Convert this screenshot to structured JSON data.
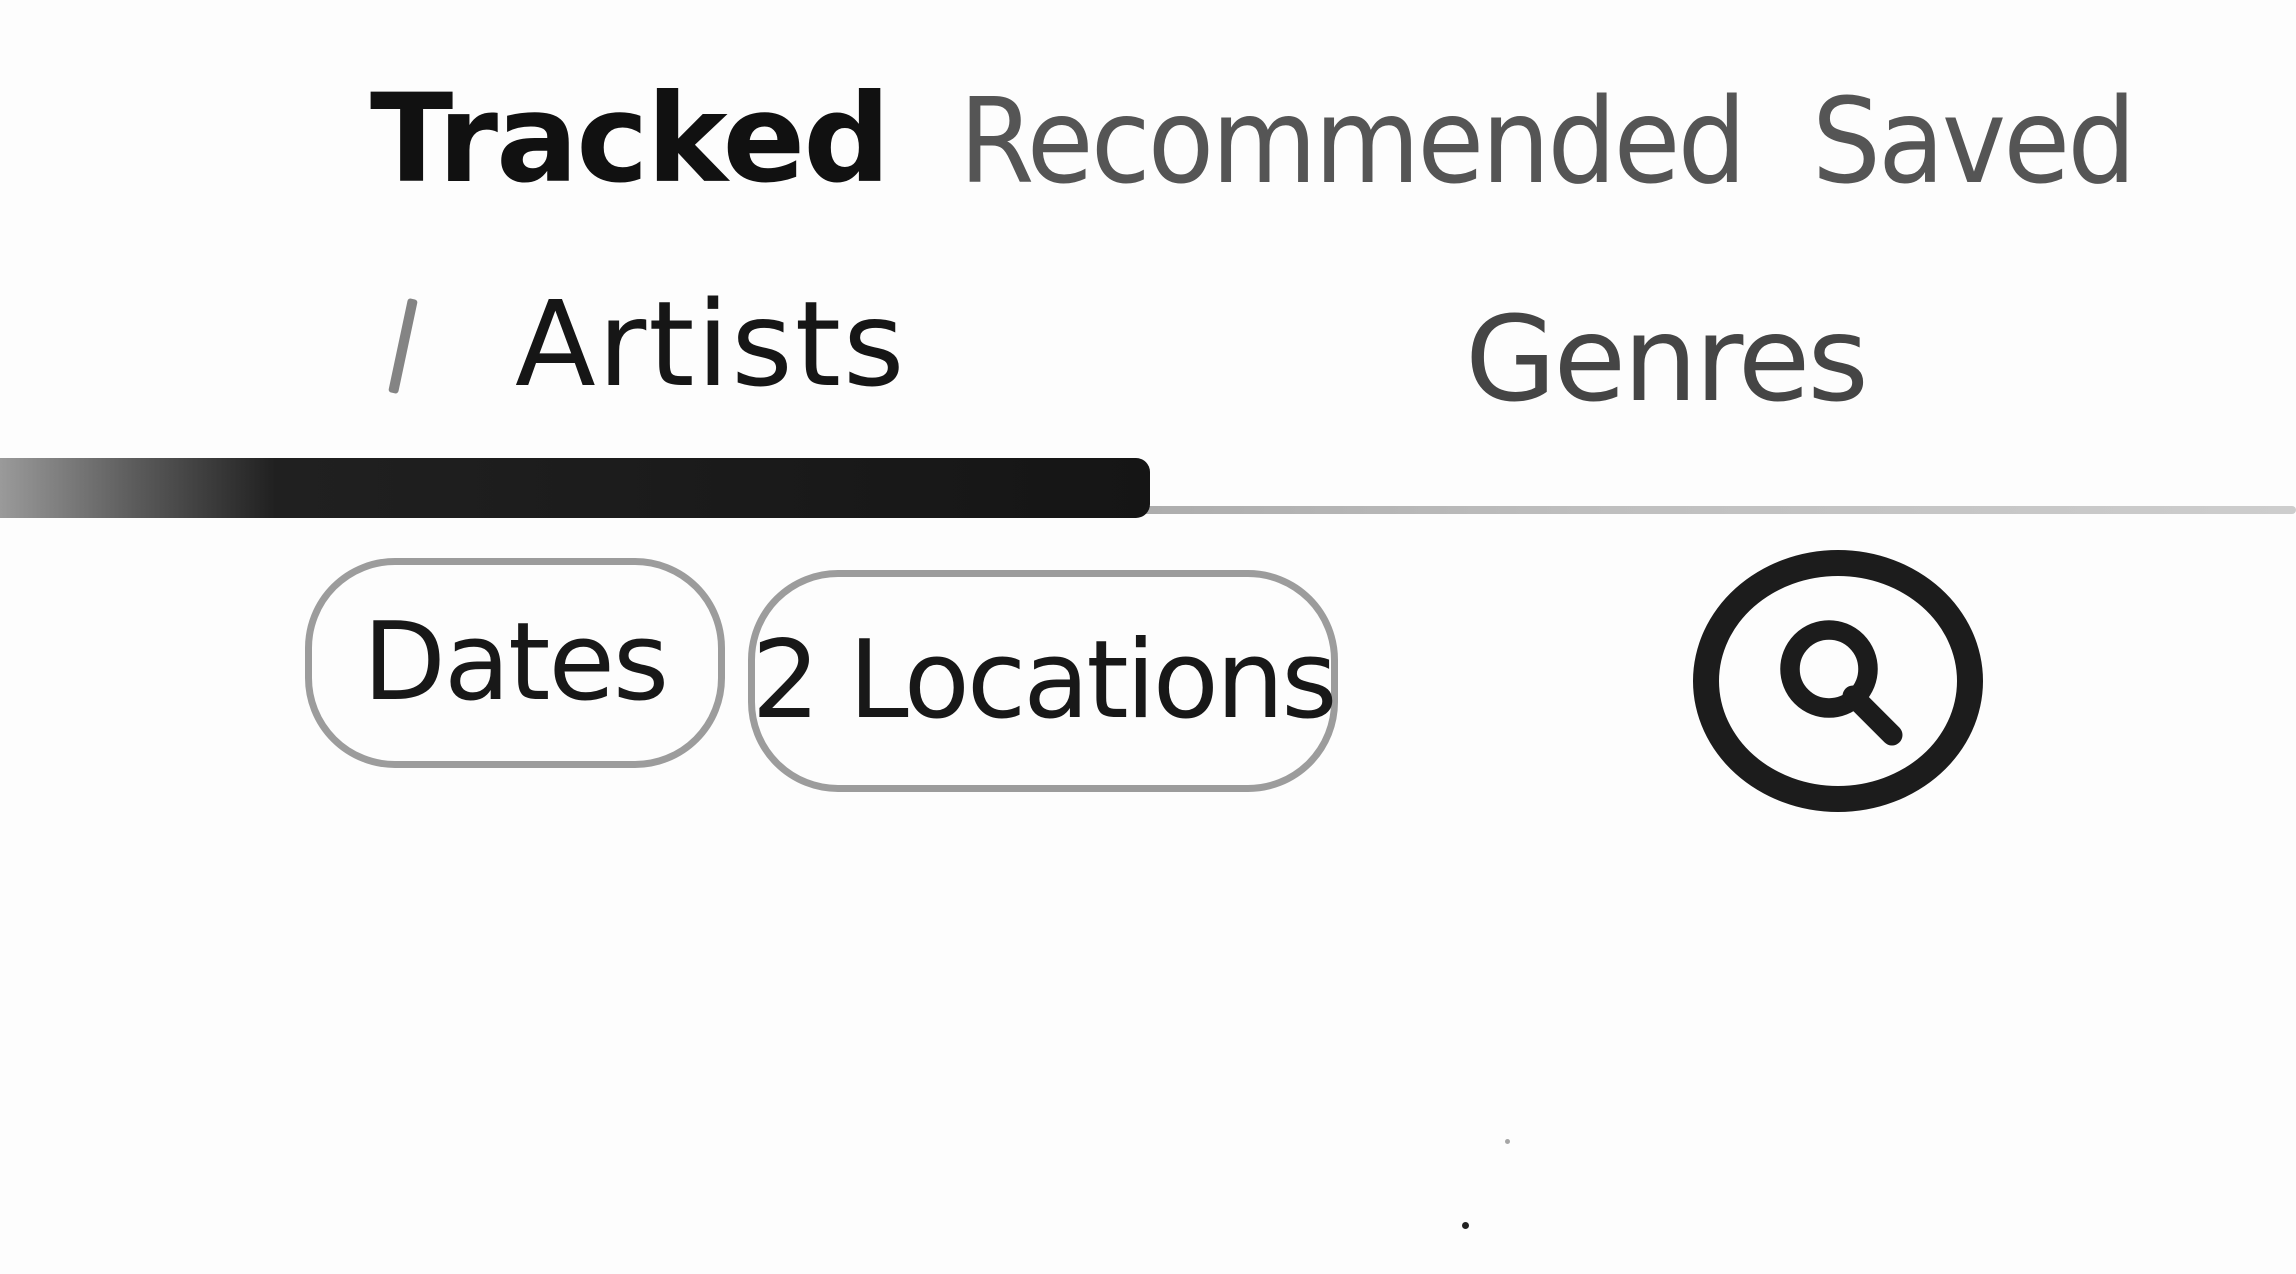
{
  "tabs": {
    "tracked": "Tracked",
    "recommended": "Recommended",
    "saved": "Saved"
  },
  "subtabs": {
    "artists": "Artists",
    "genres": "Genres"
  },
  "filters": {
    "dates": "Dates",
    "locations": "2 Locations"
  },
  "search": {
    "icon": "search-icon"
  },
  "colors": {
    "ink": "#1a1a1a",
    "light_ink": "#555555",
    "chip_border": "#9c9c9c"
  }
}
